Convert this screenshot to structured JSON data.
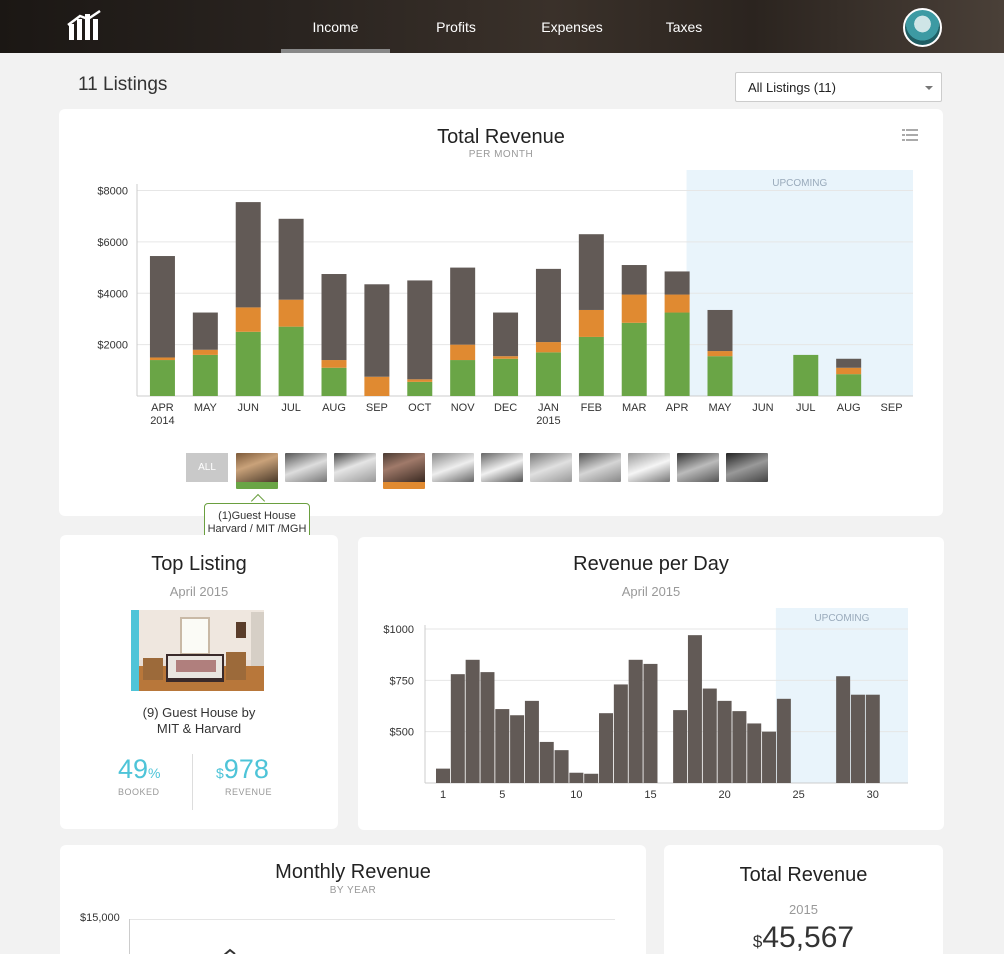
{
  "colors": {
    "green": "#6aa546",
    "orange": "#e08a31",
    "dark": "#625a56",
    "accent": "#4ec4d8",
    "upcoming": "#e9f4fb"
  },
  "nav": {
    "logo_icon": "bar-chart-logo-icon",
    "items": [
      {
        "label": "Income",
        "active": true
      },
      {
        "label": "Profits",
        "active": false
      },
      {
        "label": "Expenses",
        "active": false
      },
      {
        "label": "Taxes",
        "active": false
      }
    ],
    "avatar_icon": "user-avatar"
  },
  "header": {
    "title": "11 Listings",
    "select_value": "All Listings (11)"
  },
  "total_revenue_chart": {
    "title": "Total Revenue",
    "subtitle": "PER MONTH",
    "upcoming_label": "UPCOMING"
  },
  "thumbs": {
    "all_label": "ALL",
    "tooltip_line1": "(1)Guest House",
    "tooltip_line2": "Harvard / MIT /MGH"
  },
  "top_listing": {
    "title": "Top Listing",
    "period": "April 2015",
    "name_line1": "(9) Guest House by",
    "name_line2": "MIT & Harvard",
    "booked_value": "49",
    "booked_unit": "%",
    "booked_label": "BOOKED",
    "revenue_currency": "$",
    "revenue_value": "978",
    "revenue_label": "REVENUE"
  },
  "revenue_per_day_card": {
    "title": "Revenue per Day",
    "period": "April 2015",
    "upcoming_label": "UPCOMING"
  },
  "monthly_revenue": {
    "title": "Monthly Revenue",
    "subtitle": "BY YEAR",
    "y_top_label": "$15,000"
  },
  "total_revenue_card": {
    "title": "Total Revenue",
    "year": "2015",
    "currency": "$",
    "value": "45,567"
  },
  "chart_data": [
    {
      "type": "bar",
      "title": "Total Revenue",
      "subtitle": "PER MONTH",
      "stacked": true,
      "categories": [
        "APR",
        "MAY",
        "JUN",
        "JUL",
        "AUG",
        "SEP",
        "OCT",
        "NOV",
        "DEC",
        "JAN",
        "FEB",
        "MAR",
        "APR",
        "MAY",
        "JUN",
        "JUL",
        "AUG",
        "SEP"
      ],
      "year_labels": {
        "0": "2014",
        "9": "2015"
      },
      "yticks": [
        "$2000",
        "$4000",
        "$6000",
        "$8000"
      ],
      "ytick_values": [
        2000,
        4000,
        6000,
        8000
      ],
      "ylim": [
        0,
        8800
      ],
      "upcoming_from_index": 13,
      "series": [
        {
          "name": "",
          "color": "#6aa546",
          "values": [
            1400,
            1600,
            2500,
            2700,
            1100,
            0,
            550,
            1400,
            1450,
            1700,
            2300,
            2850,
            3250,
            1550,
            0,
            1600,
            850,
            0
          ]
        },
        {
          "name": "",
          "color": "#e08a31",
          "values": [
            100,
            200,
            950,
            1050,
            300,
            750,
            100,
            600,
            100,
            400,
            1050,
            1100,
            700,
            200,
            0,
            0,
            250,
            0
          ]
        },
        {
          "name": "",
          "color": "#625a56",
          "values": [
            3950,
            1450,
            4100,
            3150,
            3350,
            3600,
            3850,
            3000,
            1700,
            2850,
            2950,
            1150,
            900,
            1600,
            0,
            0,
            350,
            0
          ]
        }
      ]
    },
    {
      "type": "bar",
      "title": "Revenue per Day",
      "subtitle": "April 2015",
      "x": [
        1,
        2,
        3,
        4,
        5,
        6,
        7,
        8,
        9,
        10,
        11,
        12,
        13,
        14,
        15,
        16,
        17,
        18,
        19,
        20,
        21,
        22,
        23,
        24,
        25,
        26,
        27,
        28,
        29,
        30
      ],
      "xticks": [
        1,
        5,
        10,
        15,
        20,
        25,
        30
      ],
      "yticks": [
        "$500",
        "$750",
        "$1000"
      ],
      "ytick_values": [
        500,
        750,
        1000
      ],
      "ylim": [
        250,
        1000
      ],
      "upcoming_from_day": 24,
      "values": [
        320,
        780,
        850,
        790,
        610,
        580,
        650,
        450,
        410,
        300,
        295,
        590,
        730,
        850,
        830,
        0,
        605,
        970,
        710,
        650,
        600,
        540,
        500,
        660,
        0,
        0,
        0,
        770,
        680,
        680
      ]
    },
    {
      "type": "line",
      "title": "Monthly Revenue",
      "subtitle": "BY YEAR",
      "yticks": [
        "$15,000"
      ],
      "ytick_values": [
        15000
      ],
      "series": []
    }
  ]
}
